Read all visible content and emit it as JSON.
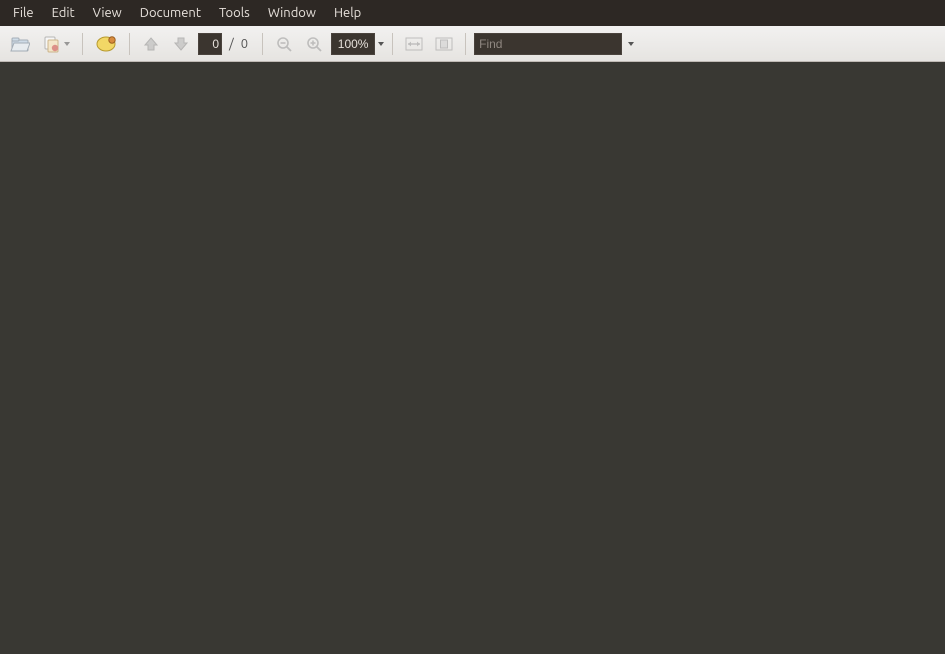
{
  "menubar": {
    "items": [
      {
        "label": "File"
      },
      {
        "label": "Edit"
      },
      {
        "label": "View"
      },
      {
        "label": "Document"
      },
      {
        "label": "Tools"
      },
      {
        "label": "Window"
      },
      {
        "label": "Help"
      }
    ]
  },
  "toolbar": {
    "icons": {
      "open": "open-icon",
      "save_copy": "save-copy-icon",
      "print": "print-icon",
      "page_up": "page-up-icon",
      "page_down": "page-down-icon",
      "zoom_out": "zoom-out-icon",
      "zoom_in": "zoom-in-icon",
      "fit_width": "fit-width-icon",
      "fit_page": "fit-page-icon"
    },
    "page": {
      "current_value": "0",
      "separator": "/",
      "total": "0"
    },
    "zoom": {
      "value": "100%"
    },
    "find": {
      "placeholder": "Find",
      "value": ""
    }
  },
  "colors": {
    "doc_area_bg": "#393833",
    "menubar_bg": "#2d2824",
    "menubar_fg": "#e6e0da",
    "toolbar_bg_top": "#f2f1f0",
    "toolbar_bg_bottom": "#e6e4e1",
    "dark_input_bg": "#3b352f"
  }
}
